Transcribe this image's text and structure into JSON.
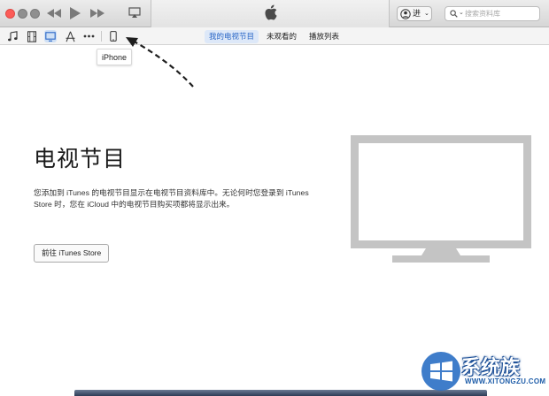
{
  "titlebar": {
    "account_label": "进",
    "search_placeholder": "搜索资料库"
  },
  "icons": {
    "music": "music-icon",
    "movies": "film-icon",
    "tv": "tv-icon",
    "apps": "app-store-icon",
    "more": "more-icon",
    "device": "iphone-icon"
  },
  "tabs": [
    {
      "label": "我的电视节目",
      "active": true
    },
    {
      "label": "未观看的",
      "active": false
    },
    {
      "label": "播放列表",
      "active": false
    }
  ],
  "tooltip": "iPhone",
  "main": {
    "title": "电视节目",
    "description": "您添加到 iTunes 的电视节目显示在电视节目资料库中。无论何时您登录到 iTunes Store 时，您在 iCloud 中的电视节目购买项都将显示出来。",
    "store_button": "前往 iTunes Store"
  },
  "watermark": {
    "title": "系统族",
    "url": "WWW.XITONGZU.COM"
  },
  "colors": {
    "accent": "#2865c6",
    "selected_tab_bg": "#dde8f8",
    "tv_gray": "#c4c4c4",
    "close_light": "#fc5b57"
  }
}
